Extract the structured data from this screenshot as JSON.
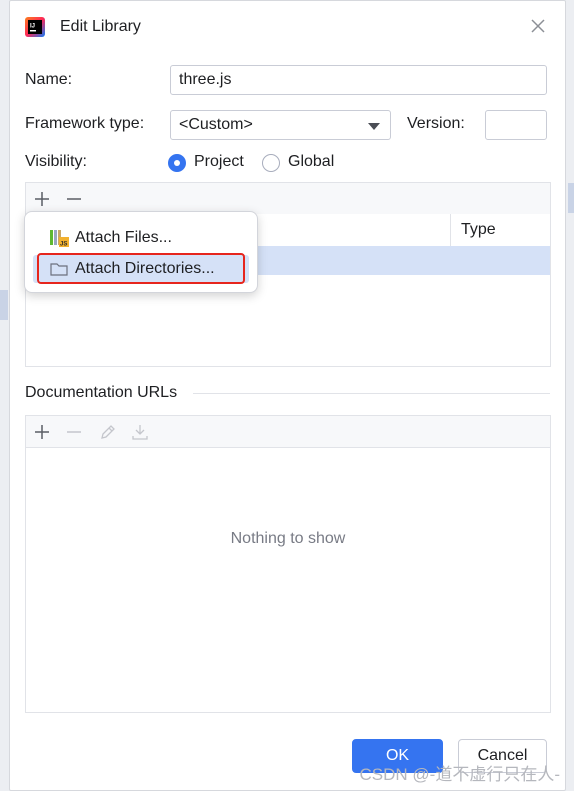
{
  "dialog": {
    "title": "Edit Library",
    "app_icon": "intellij-logo-icon",
    "close_icon": "close-icon"
  },
  "form": {
    "name_label": "Name:",
    "name_value": "three.js",
    "framework_label": "Framework type:",
    "framework_value": "<Custom>",
    "version_label": "Version:",
    "version_value": "",
    "visibility_label": "Visibility:",
    "visibility_options": [
      {
        "label": "Project",
        "selected": true
      },
      {
        "label": "Global",
        "selected": false
      }
    ]
  },
  "roots_panel": {
    "column_type": "Type"
  },
  "popup_menu": {
    "items": [
      {
        "label": "Attach Files...",
        "icon": "js-files-icon"
      },
      {
        "label": "Attach Directories...",
        "icon": "folder-icon"
      }
    ]
  },
  "docs": {
    "section_title": "Documentation URLs",
    "empty_text": "Nothing to show"
  },
  "buttons": {
    "ok": "OK",
    "cancel": "Cancel"
  },
  "watermark": "CSDN @-道不虚行只在人-",
  "colors": {
    "accent": "#3574f0",
    "selection": "#d5e1f7",
    "highlight_border": "#e6251d"
  }
}
